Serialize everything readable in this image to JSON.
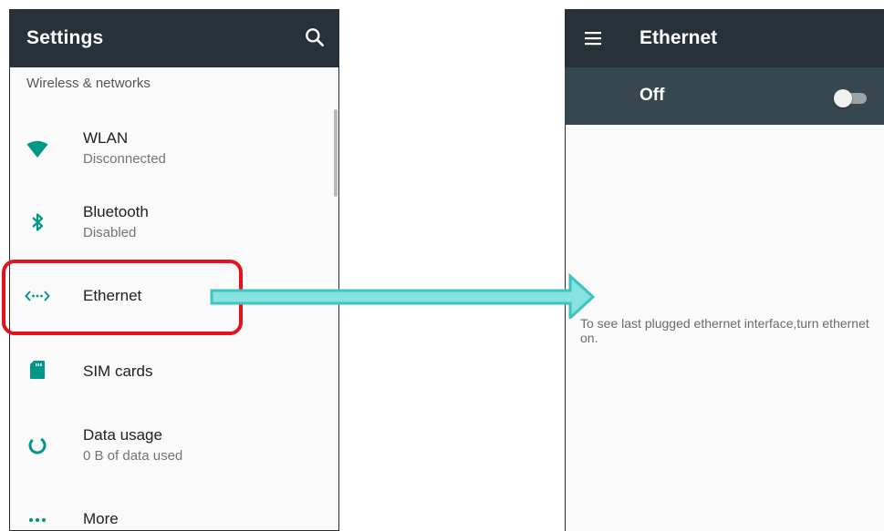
{
  "settings_screen": {
    "title": "Settings",
    "section_header": "Wireless & networks",
    "items": [
      {
        "label": "WLAN",
        "summary": "Disconnected",
        "icon": "wifi-icon"
      },
      {
        "label": "Bluetooth",
        "summary": "Disabled",
        "icon": "bluetooth-icon"
      },
      {
        "label": "Ethernet",
        "summary": "",
        "icon": "ethernet-icon"
      },
      {
        "label": "SIM cards",
        "summary": "",
        "icon": "sim-card-icon"
      },
      {
        "label": "Data usage",
        "summary": "0 B of data used",
        "icon": "data-usage-icon"
      },
      {
        "label": "More",
        "summary": "",
        "icon": "more-icon"
      }
    ]
  },
  "ethernet_screen": {
    "title": "Ethernet",
    "switch_label": "Off",
    "switch_on": false,
    "empty_message": "To see last plugged ethernet interface,turn ethernet on."
  },
  "colors": {
    "toolbar": "#263238",
    "switch_bar": "#37474f",
    "accent": "#009688",
    "highlight": "#e4121d",
    "arrow": "#4fd1d1"
  }
}
